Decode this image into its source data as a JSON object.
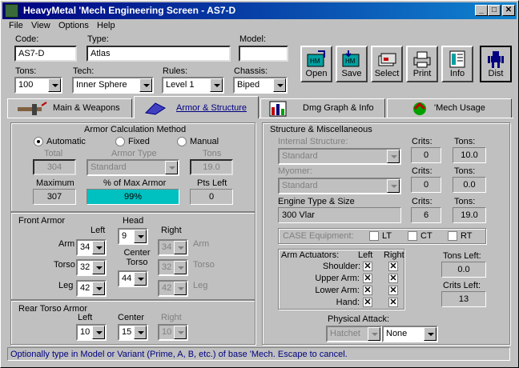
{
  "window": {
    "title": "HeavyMetal 'Mech Engineering Screen - AS7-D"
  },
  "menu": [
    "File",
    "View",
    "Options",
    "Help"
  ],
  "header": {
    "code_label": "Code:",
    "code": "AS7-D",
    "type_label": "Type:",
    "type": "Atlas",
    "model_label": "Model:",
    "model": "",
    "tons_label": "Tons:",
    "tons": "100",
    "tech_label": "Tech:",
    "tech": "Inner Sphere",
    "rules_label": "Rules:",
    "rules": "Level 1",
    "chassis_label": "Chassis:",
    "chassis": "Biped"
  },
  "toolbar": [
    "Open",
    "Save",
    "Select",
    "Print",
    "Info",
    "Dist"
  ],
  "tabs": [
    "Main & Weapons",
    "Armor & Structure",
    "Dmg Graph & Info",
    "'Mech Usage"
  ],
  "armor_calc": {
    "title": "Armor Calculation Method",
    "options": [
      "Automatic",
      "Fixed",
      "Manual"
    ],
    "total_label": "Total",
    "total": "304",
    "armor_type_label": "Armor Type",
    "armor_type": "Standard",
    "tons_label": "Tons",
    "tons": "19.0",
    "max_label": "Maximum",
    "max": "307",
    "pct_label": "% of Max Armor",
    "pct": "99%",
    "pts_left_label": "Pts Left",
    "pts_left": "0"
  },
  "front_armor": {
    "title": "Front Armor",
    "head_label": "Head",
    "head": "9",
    "left_label": "Left",
    "right_label": "Right",
    "center_torso_label": "Center Torso",
    "arm_label": "Arm",
    "torso_label": "Torso",
    "leg_label": "Leg",
    "left_arm": "34",
    "left_torso": "32",
    "left_leg": "42",
    "center_torso": "44",
    "right_arm": "34",
    "right_torso": "32",
    "right_leg": "42"
  },
  "rear_armor": {
    "title": "Rear Torso Armor",
    "left_label": "Left",
    "center_label": "Center",
    "right_label": "Right",
    "left": "10",
    "center": "15",
    "right": "10"
  },
  "structure": {
    "title": "Structure & Miscellaneous",
    "internal_label": "Internal Structure:",
    "internal": "Standard",
    "crits_label": "Crits:",
    "tons_label": "Tons:",
    "internal_crits": "0",
    "internal_tons": "10.0",
    "myomer_label": "Myomer:",
    "myomer": "Standard",
    "myomer_crits": "0",
    "myomer_tons": "0.0",
    "engine_label": "Engine Type & Size",
    "engine": "300 Vlar",
    "engine_crits": "6",
    "engine_tons": "19.0",
    "case_label": "CASE Equipment:",
    "case_lt": "LT",
    "case_ct": "CT",
    "case_rt": "RT",
    "actuators_label": "Arm Actuators:",
    "act_left": "Left",
    "act_right": "Right",
    "actuators": [
      "Shoulder:",
      "Upper Arm:",
      "Lower Arm:",
      "Hand:"
    ],
    "tons_left_label": "Tons Left:",
    "tons_left": "0.0",
    "crits_left_label": "Crits Left:",
    "crits_left": "13",
    "physical_label": "Physical Attack:",
    "physical": "Hatchet",
    "physical2": "None"
  },
  "status": "Optionally type in Model or Variant (Prime, A, B, etc.) of base 'Mech. Escape to cancel.",
  "colors": {
    "title_start": "#000080",
    "title_end": "#1084d0",
    "progress": "#00a0a0"
  }
}
